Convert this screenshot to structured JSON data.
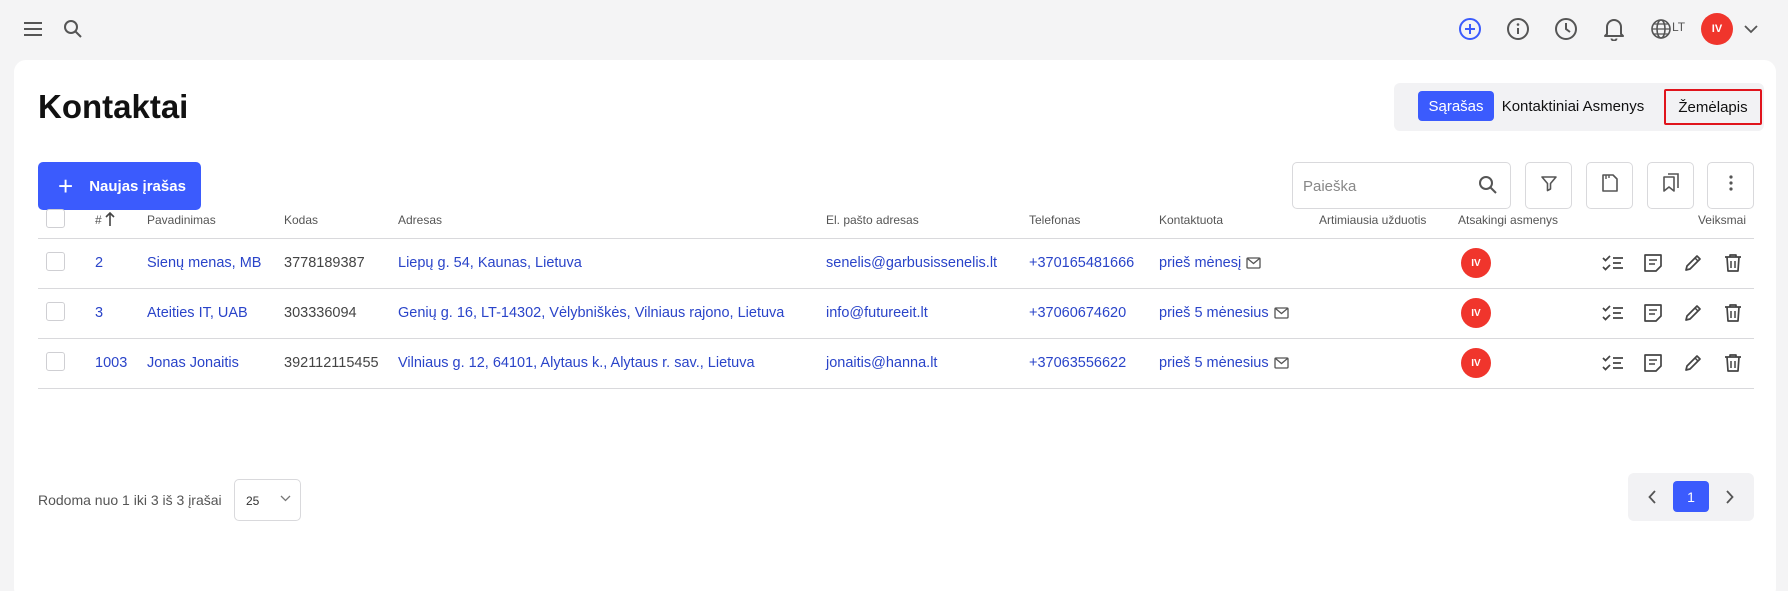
{
  "topbar": {
    "icons": [
      "menu-icon",
      "search-icon",
      "add-circle-icon",
      "info-icon",
      "clock-icon",
      "bell-icon",
      "globe-icon"
    ],
    "language": "LT",
    "user_initials": "IV"
  },
  "page": {
    "title": "Kontaktai",
    "views": [
      "Sąrašas",
      "Kontaktiniai Asmenys",
      "Žemėlapis"
    ],
    "active_view": "Sąrašas",
    "highlighted_view": "Žemėlapis"
  },
  "toolbar": {
    "new_label": "Naujas įrašas",
    "search_placeholder": "Paieška",
    "tools": [
      "filter-icon",
      "document-icon",
      "bookmarks-icon",
      "more-vertical-icon"
    ]
  },
  "table": {
    "headers": {
      "num": "#",
      "name": "Pavadinimas",
      "code": "Kodas",
      "address": "Adresas",
      "email": "El. pašto adresas",
      "phone": "Telefonas",
      "contacted": "Kontaktuota",
      "nearest_task": "Artimiausia užduotis",
      "responsible": "Atsakingi asmenys",
      "actions": "Veiksmai"
    },
    "rows": [
      {
        "num": "2",
        "name": "Sienų menas, MB",
        "code": "3778189387",
        "address": "Liepų g. 54, Kaunas, Lietuva",
        "email": "senelis@garbusissenelis.lt",
        "phone": "+370165481666",
        "contacted": "prieš mėnesį",
        "task": "",
        "responsible": "IV"
      },
      {
        "num": "3",
        "name": "Ateities IT, UAB",
        "code": "303336094",
        "address": "Genių g. 16, LT-14302, Vėlybniškės, Vilniaus rajono, Lietuva",
        "email": "info@futureeit.lt",
        "phone": "+37060674620",
        "contacted": "prieš 5 mėnesius",
        "task": "",
        "responsible": "IV"
      },
      {
        "num": "1003",
        "name": "Jonas Jonaitis",
        "code": "392112115455",
        "address": "Vilniaus g. 12, 64101, Alytaus k., Alytaus r. sav., Lietuva",
        "email": "jonaitis@hanna.lt",
        "phone": "+37063556622",
        "contacted": "prieš 5 mėnesius",
        "task": "",
        "responsible": "IV"
      }
    ],
    "row_actions": [
      "tasks-icon",
      "note-icon",
      "edit-icon",
      "trash-icon"
    ]
  },
  "footer": {
    "summary": "Rodoma nuo 1 iki 3 iš 3 įrašai",
    "page_size": "25",
    "current_page": "1"
  },
  "colors": {
    "accent": "#3b5bfd",
    "link": "#2a44c9",
    "avatar": "#f0352c",
    "highlight_border": "#e0141c"
  }
}
